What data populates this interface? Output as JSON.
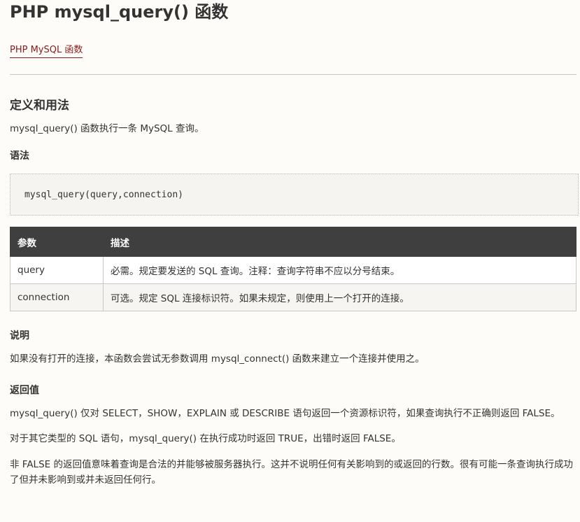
{
  "page": {
    "title": "PHP mysql_query() 函数",
    "category_link": "PHP MySQL 函数"
  },
  "definition": {
    "heading": "定义和用法",
    "text": "mysql_query() 函数执行一条 MySQL 查询。"
  },
  "syntax": {
    "heading": "语法",
    "code": "mysql_query(query,connection)"
  },
  "params_table": {
    "headers": [
      "参数",
      "描述"
    ],
    "rows": [
      {
        "name": "query",
        "desc": "必需。规定要发送的 SQL 查询。注释：查询字符串不应以分号结束。"
      },
      {
        "name": "connection",
        "desc": "可选。规定 SQL 连接标识符。如果未规定，则使用上一个打开的连接。"
      }
    ]
  },
  "explanation": {
    "heading": "说明",
    "text": "如果没有打开的连接，本函数会尝试无参数调用 mysql_connect() 函数来建立一个连接并使用之。"
  },
  "return_value": {
    "heading": "返回值",
    "p1": "mysql_query() 仅对 SELECT，SHOW，EXPLAIN 或 DESCRIBE 语句返回一个资源标识符，如果查询执行不正确则返回 FALSE。",
    "p2": "对于其它类型的 SQL 语句，mysql_query() 在执行成功时返回 TRUE，出错时返回 FALSE。",
    "p3": "非 FALSE 的返回值意味着查询是合法的并能够被服务器执行。这并不说明任何有关影响到的或返回的行数。很有可能一条查询执行成功了但并未影响到或并未返回任何行。"
  },
  "colors": {
    "link": "#8b1a1a",
    "table_header_bg": "#3f3f3f",
    "text": "#333333"
  }
}
